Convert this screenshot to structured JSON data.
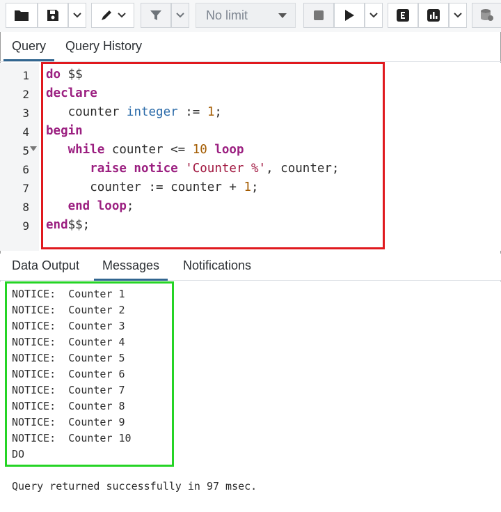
{
  "toolbar": {
    "limit_label": "No limit",
    "icons": [
      "folder-icon",
      "save-icon",
      "chevron-down-icon",
      "pencil-icon",
      "chevron-down-icon",
      "filter-icon",
      "chevron-down-icon",
      "stop-icon",
      "play-icon",
      "chevron-down-icon",
      "explain-icon",
      "explain-analyze-icon",
      "chevron-down-icon",
      "database-commit-icon"
    ]
  },
  "editor_tabs": [
    {
      "label": "Query",
      "active": true
    },
    {
      "label": "Query History",
      "active": false
    }
  ],
  "editor": {
    "line_numbers": [
      "1",
      "2",
      "3",
      "4",
      "5",
      "6",
      "7",
      "8",
      "9"
    ],
    "lines": [
      [
        {
          "t": "kw",
          "v": "do"
        },
        {
          "t": "",
          "v": " $$"
        }
      ],
      [
        {
          "t": "kw",
          "v": "declare"
        }
      ],
      [
        {
          "t": "",
          "v": "   counter "
        },
        {
          "t": "typ",
          "v": "integer"
        },
        {
          "t": "",
          "v": " := "
        },
        {
          "t": "num",
          "v": "1"
        },
        {
          "t": "",
          "v": ";"
        }
      ],
      [
        {
          "t": "kw",
          "v": "begin"
        }
      ],
      [
        {
          "t": "",
          "v": "   "
        },
        {
          "t": "kw",
          "v": "while"
        },
        {
          "t": "",
          "v": " counter <= "
        },
        {
          "t": "num",
          "v": "10"
        },
        {
          "t": "",
          "v": " "
        },
        {
          "t": "kw",
          "v": "loop"
        }
      ],
      [
        {
          "t": "",
          "v": "      "
        },
        {
          "t": "kw",
          "v": "raise notice"
        },
        {
          "t": "",
          "v": " "
        },
        {
          "t": "str",
          "v": "'Counter %'"
        },
        {
          "t": "",
          "v": ", counter;"
        }
      ],
      [
        {
          "t": "",
          "v": "      counter := counter + "
        },
        {
          "t": "num",
          "v": "1"
        },
        {
          "t": "",
          "v": ";"
        }
      ],
      [
        {
          "t": "",
          "v": "   "
        },
        {
          "t": "kw",
          "v": "end loop"
        },
        {
          "t": "",
          "v": ";"
        }
      ],
      [
        {
          "t": "kw",
          "v": "end"
        },
        {
          "t": "",
          "v": "$$;"
        }
      ]
    ]
  },
  "result_tabs": [
    {
      "label": "Data Output",
      "active": false
    },
    {
      "label": "Messages",
      "active": true
    },
    {
      "label": "Notifications",
      "active": false
    }
  ],
  "messages": [
    "NOTICE:  Counter 1",
    "NOTICE:  Counter 2",
    "NOTICE:  Counter 3",
    "NOTICE:  Counter 4",
    "NOTICE:  Counter 5",
    "NOTICE:  Counter 6",
    "NOTICE:  Counter 7",
    "NOTICE:  Counter 8",
    "NOTICE:  Counter 9",
    "NOTICE:  Counter 10",
    "DO"
  ],
  "status": "Query returned successfully in 97 msec.",
  "colors": {
    "highlight_red": "#e0191e",
    "highlight_green": "#25d425",
    "tab_accent": "#326690"
  }
}
